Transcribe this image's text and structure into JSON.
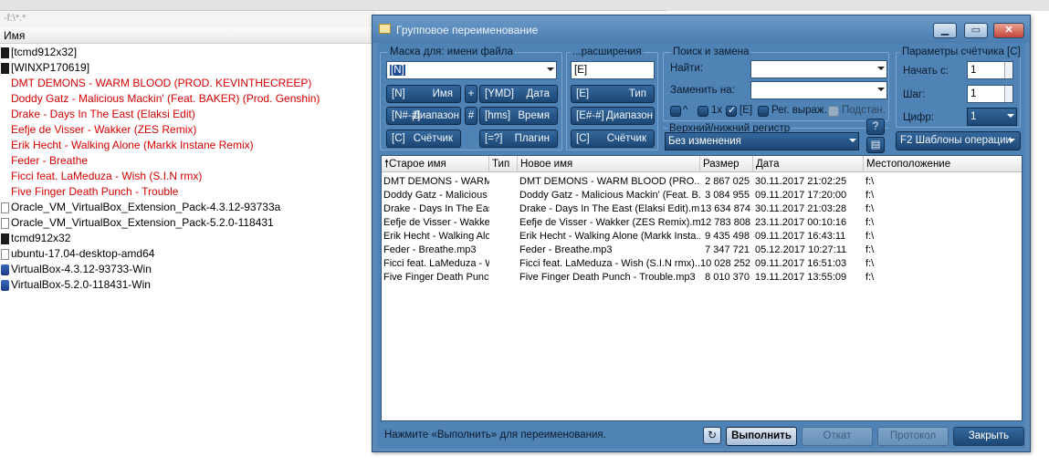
{
  "background": {
    "path": "-f:\\*.*",
    "column_name": "Имя",
    "files": [
      {
        "name": "[tcmd912x32]",
        "icon": "folder-icon",
        "red": false
      },
      {
        "name": "[WINXP170619]",
        "icon": "folder-icon",
        "red": false
      },
      {
        "name": "DMT DEMONS - WARM BLOOD (PROD. KEVINTHECREEP)",
        "icon": "none",
        "red": true
      },
      {
        "name": "Doddy Gatz - Malicious Mackin' (Feat. BAKER) (Prod. Genshin)",
        "icon": "none",
        "red": true
      },
      {
        "name": "Drake - Days In The East (Elaksi Edit)",
        "icon": "none",
        "red": true
      },
      {
        "name": "Eefje de Visser - Wakker (ZES Remix)",
        "icon": "none",
        "red": true
      },
      {
        "name": "Erik Hecht - Walking Alone (Markk Instane Remix)",
        "icon": "none",
        "red": true
      },
      {
        "name": "Feder - Breathe",
        "icon": "none",
        "red": true
      },
      {
        "name": "Ficci feat. LaMeduza - Wish (S.I.N rmx)",
        "icon": "none",
        "red": true
      },
      {
        "name": "Five Finger Death Punch - Trouble",
        "icon": "none",
        "red": true
      },
      {
        "name": "Oracle_VM_VirtualBox_Extension_Pack-4.3.12-93733a",
        "icon": "doc-icon",
        "red": false
      },
      {
        "name": "Oracle_VM_VirtualBox_Extension_Pack-5.2.0-118431",
        "icon": "doc-icon",
        "red": false
      },
      {
        "name": "tcmd912x32",
        "icon": "app-icon",
        "red": false
      },
      {
        "name": "ubuntu-17.04-desktop-amd64",
        "icon": "doc-icon",
        "red": false
      },
      {
        "name": "VirtualBox-4.3.12-93733-Win",
        "icon": "vbox-icon",
        "red": false
      },
      {
        "name": "VirtualBox-5.2.0-118431-Win",
        "icon": "vbox-icon",
        "red": false
      }
    ]
  },
  "dialog": {
    "title": "Групповое переименование",
    "mask_group": {
      "title": "Маска для: имени файла",
      "value": "[N]",
      "buttons": [
        {
          "code": "[N]",
          "label": "Имя"
        },
        {
          "code": "[N#-#]",
          "label": "Диапазон"
        },
        {
          "code": "[C]",
          "label": "Счётчик"
        }
      ],
      "small": [
        "+",
        "#"
      ],
      "date_buttons": [
        {
          "code": "[YMD]",
          "label": "Дата"
        },
        {
          "code": "[hms]",
          "label": "Время"
        },
        {
          "code": "[=?]",
          "label": "Плагин"
        }
      ]
    },
    "ext_group": {
      "title": "...расширения",
      "value": "[E]",
      "buttons": [
        {
          "code": "[E]",
          "label": "Тип"
        },
        {
          "code": "[E#-#]",
          "label": "Диапазон"
        },
        {
          "code": "[C]",
          "label": "Счётчик"
        }
      ]
    },
    "search_group": {
      "title": "Поиск и замена",
      "find_label": "Найти:",
      "replace_label": "Заменить на:",
      "options": [
        {
          "label": "^",
          "checked": false,
          "disabled": false
        },
        {
          "label": "1x",
          "checked": false,
          "disabled": false
        },
        {
          "label": "[E]",
          "checked": true,
          "disabled": false
        },
        {
          "label": "Рег. выраж.",
          "checked": false,
          "disabled": false
        },
        {
          "label": "Подстан.",
          "checked": false,
          "disabled": true
        }
      ]
    },
    "case_group": {
      "title": "Верхний/нижний регистр",
      "value": "Без изменения",
      "help": "?"
    },
    "counter_group": {
      "title": "Параметры счётчика [C]",
      "start_label": "Начать с:",
      "start_value": "1",
      "step_label": "Шаг:",
      "step_value": "1",
      "digits_label": "Цифр:",
      "digits_value": "1",
      "templates": "F2 Шаблоны операции"
    },
    "grid": {
      "columns": [
        "Старое имя",
        "Тип",
        "Новое имя",
        "Размер",
        "Дата",
        "Местоположение"
      ],
      "rows": [
        [
          "DMT DEMONS - WARM BL...",
          "",
          "DMT DEMONS - WARM BLOOD (PRO...",
          "2 867 025",
          "30.11.2017 21:02:25",
          "f:\\"
        ],
        [
          "Doddy Gatz - Malicious Mac...",
          "",
          "Doddy Gatz - Malicious Mackin' (Feat. B...",
          "3 084 955",
          "09.11.2017 17:20:00",
          "f:\\"
        ],
        [
          "Drake - Days In The East (El...",
          "",
          "Drake - Days In The East (Elaksi Edit).m...",
          "13 634 874",
          "30.11.2017 21:03:28",
          "f:\\"
        ],
        [
          "Eefje de Visser - Wakker (Z...",
          "",
          "Eefje de Visser - Wakker (ZES Remix).m...",
          "12 783 808",
          "23.11.2017 00:10:16",
          "f:\\"
        ],
        [
          "Erik Hecht - Walking Alone (...",
          "",
          "Erik Hecht - Walking Alone (Markk Insta...",
          "9 435 498",
          "09.11.2017 16:43:11",
          "f:\\"
        ],
        [
          "Feder - Breathe.mp3",
          "",
          "Feder - Breathe.mp3",
          "7 347 721",
          "05.12.2017 10:27:11",
          "f:\\"
        ],
        [
          "Ficci feat. LaMeduza - Wish ...",
          "",
          "Ficci feat. LaMeduza - Wish (S.I.N rmx)...",
          "10 028 252",
          "09.11.2017 16:51:03",
          "f:\\"
        ],
        [
          "Five Finger Death Punch - T...",
          "",
          "Five Finger Death Punch - Trouble.mp3",
          "8 010 370",
          "19.11.2017 13:55:09",
          "f:\\"
        ]
      ]
    },
    "status": "Нажмите «Выполнить» для переименования.",
    "buttons": {
      "run": "Выполнить",
      "undo": "Откат",
      "log": "Протокол",
      "close": "Закрыть"
    }
  }
}
